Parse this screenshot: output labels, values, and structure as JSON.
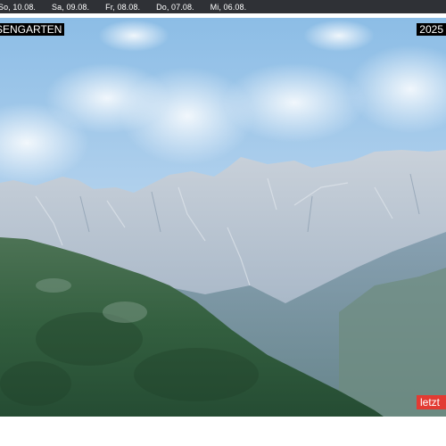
{
  "date_tabs": [
    "So, 10.08.",
    "Sa, 09.08.",
    "Fr, 08.08.",
    "Do, 07.08.",
    "Mi, 06.08."
  ],
  "overlay": {
    "location_label": "SENGARTEN",
    "year_label": "2025",
    "badge_label": "letzt"
  },
  "colors": {
    "date_bar": "#2f3136",
    "badge": "#e23b33",
    "sky_top": "#8fbfe6",
    "forest": "#2e5a3a"
  }
}
